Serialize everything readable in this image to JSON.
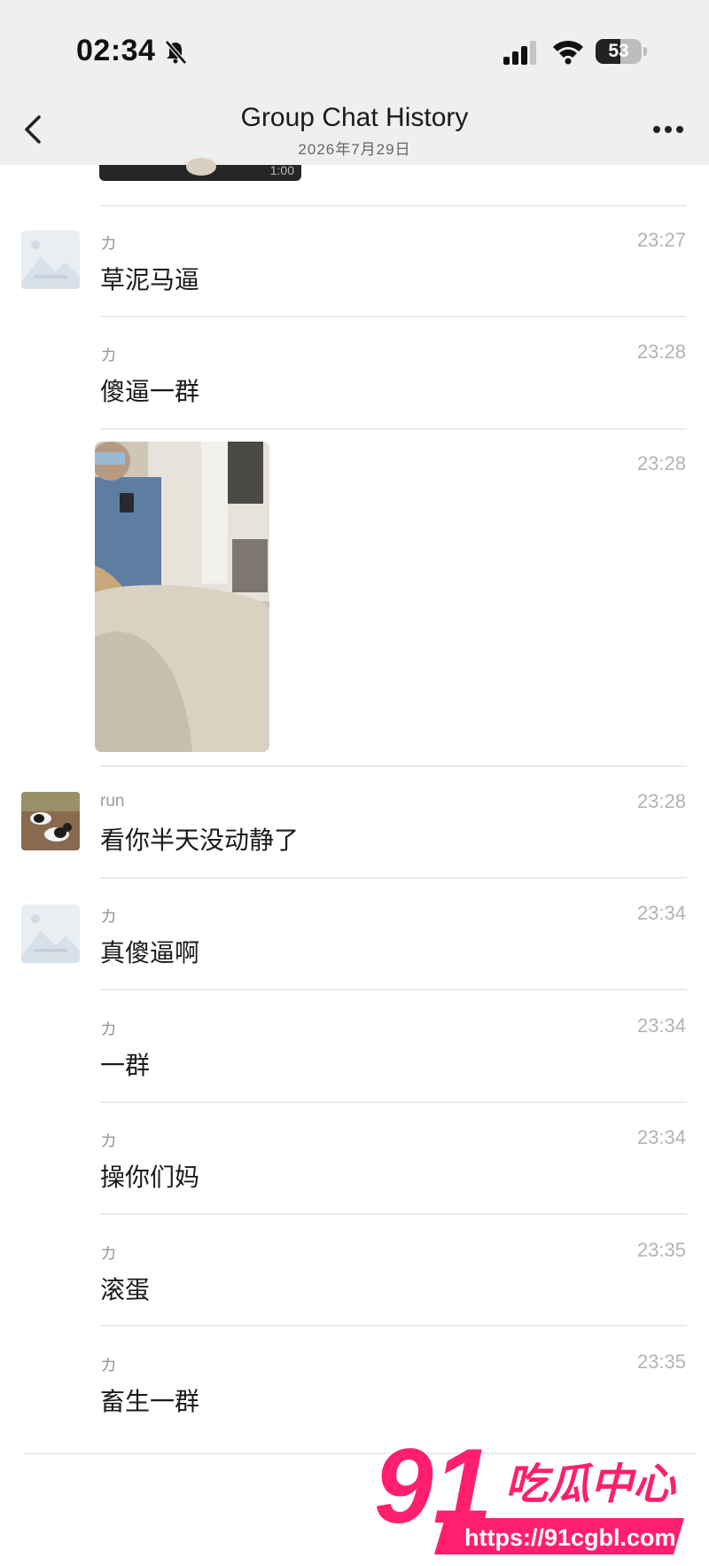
{
  "status_bar": {
    "time": "02:34",
    "battery_percent": "53",
    "battery_level": 0.53
  },
  "header": {
    "title": "Group Chat History",
    "subtitle": "2026年7月29日"
  },
  "top_video": {
    "duration": "1:00"
  },
  "messages": [
    {
      "sender": "カ",
      "time": "23:27",
      "text": "草泥马逼",
      "avatar": "placeholder-image"
    },
    {
      "sender": "カ",
      "time": "23:28",
      "text": "傻逼一群"
    },
    {
      "time": "23:28",
      "type": "image"
    },
    {
      "sender": "run",
      "time": "23:28",
      "text": "看你半天没动静了",
      "avatar": "cat-photo"
    },
    {
      "sender": "カ",
      "time": "23:34",
      "text": "真傻逼啊",
      "avatar": "placeholder-image"
    },
    {
      "sender": "カ",
      "time": "23:34",
      "text": "一群"
    },
    {
      "sender": "カ",
      "time": "23:34",
      "text": "操你们妈"
    },
    {
      "sender": "カ",
      "time": "23:35",
      "text": "滚蛋"
    },
    {
      "sender": "カ",
      "time": "23:35",
      "text": "畜生一群"
    }
  ],
  "watermark": {
    "number": "91",
    "brand": "吃瓜中心",
    "url": "https://91cgbl.com"
  },
  "colors": {
    "header_bg": "#efefef",
    "timestamp": "#b3b3b3",
    "watermark_pink": "#ff1f6e"
  }
}
